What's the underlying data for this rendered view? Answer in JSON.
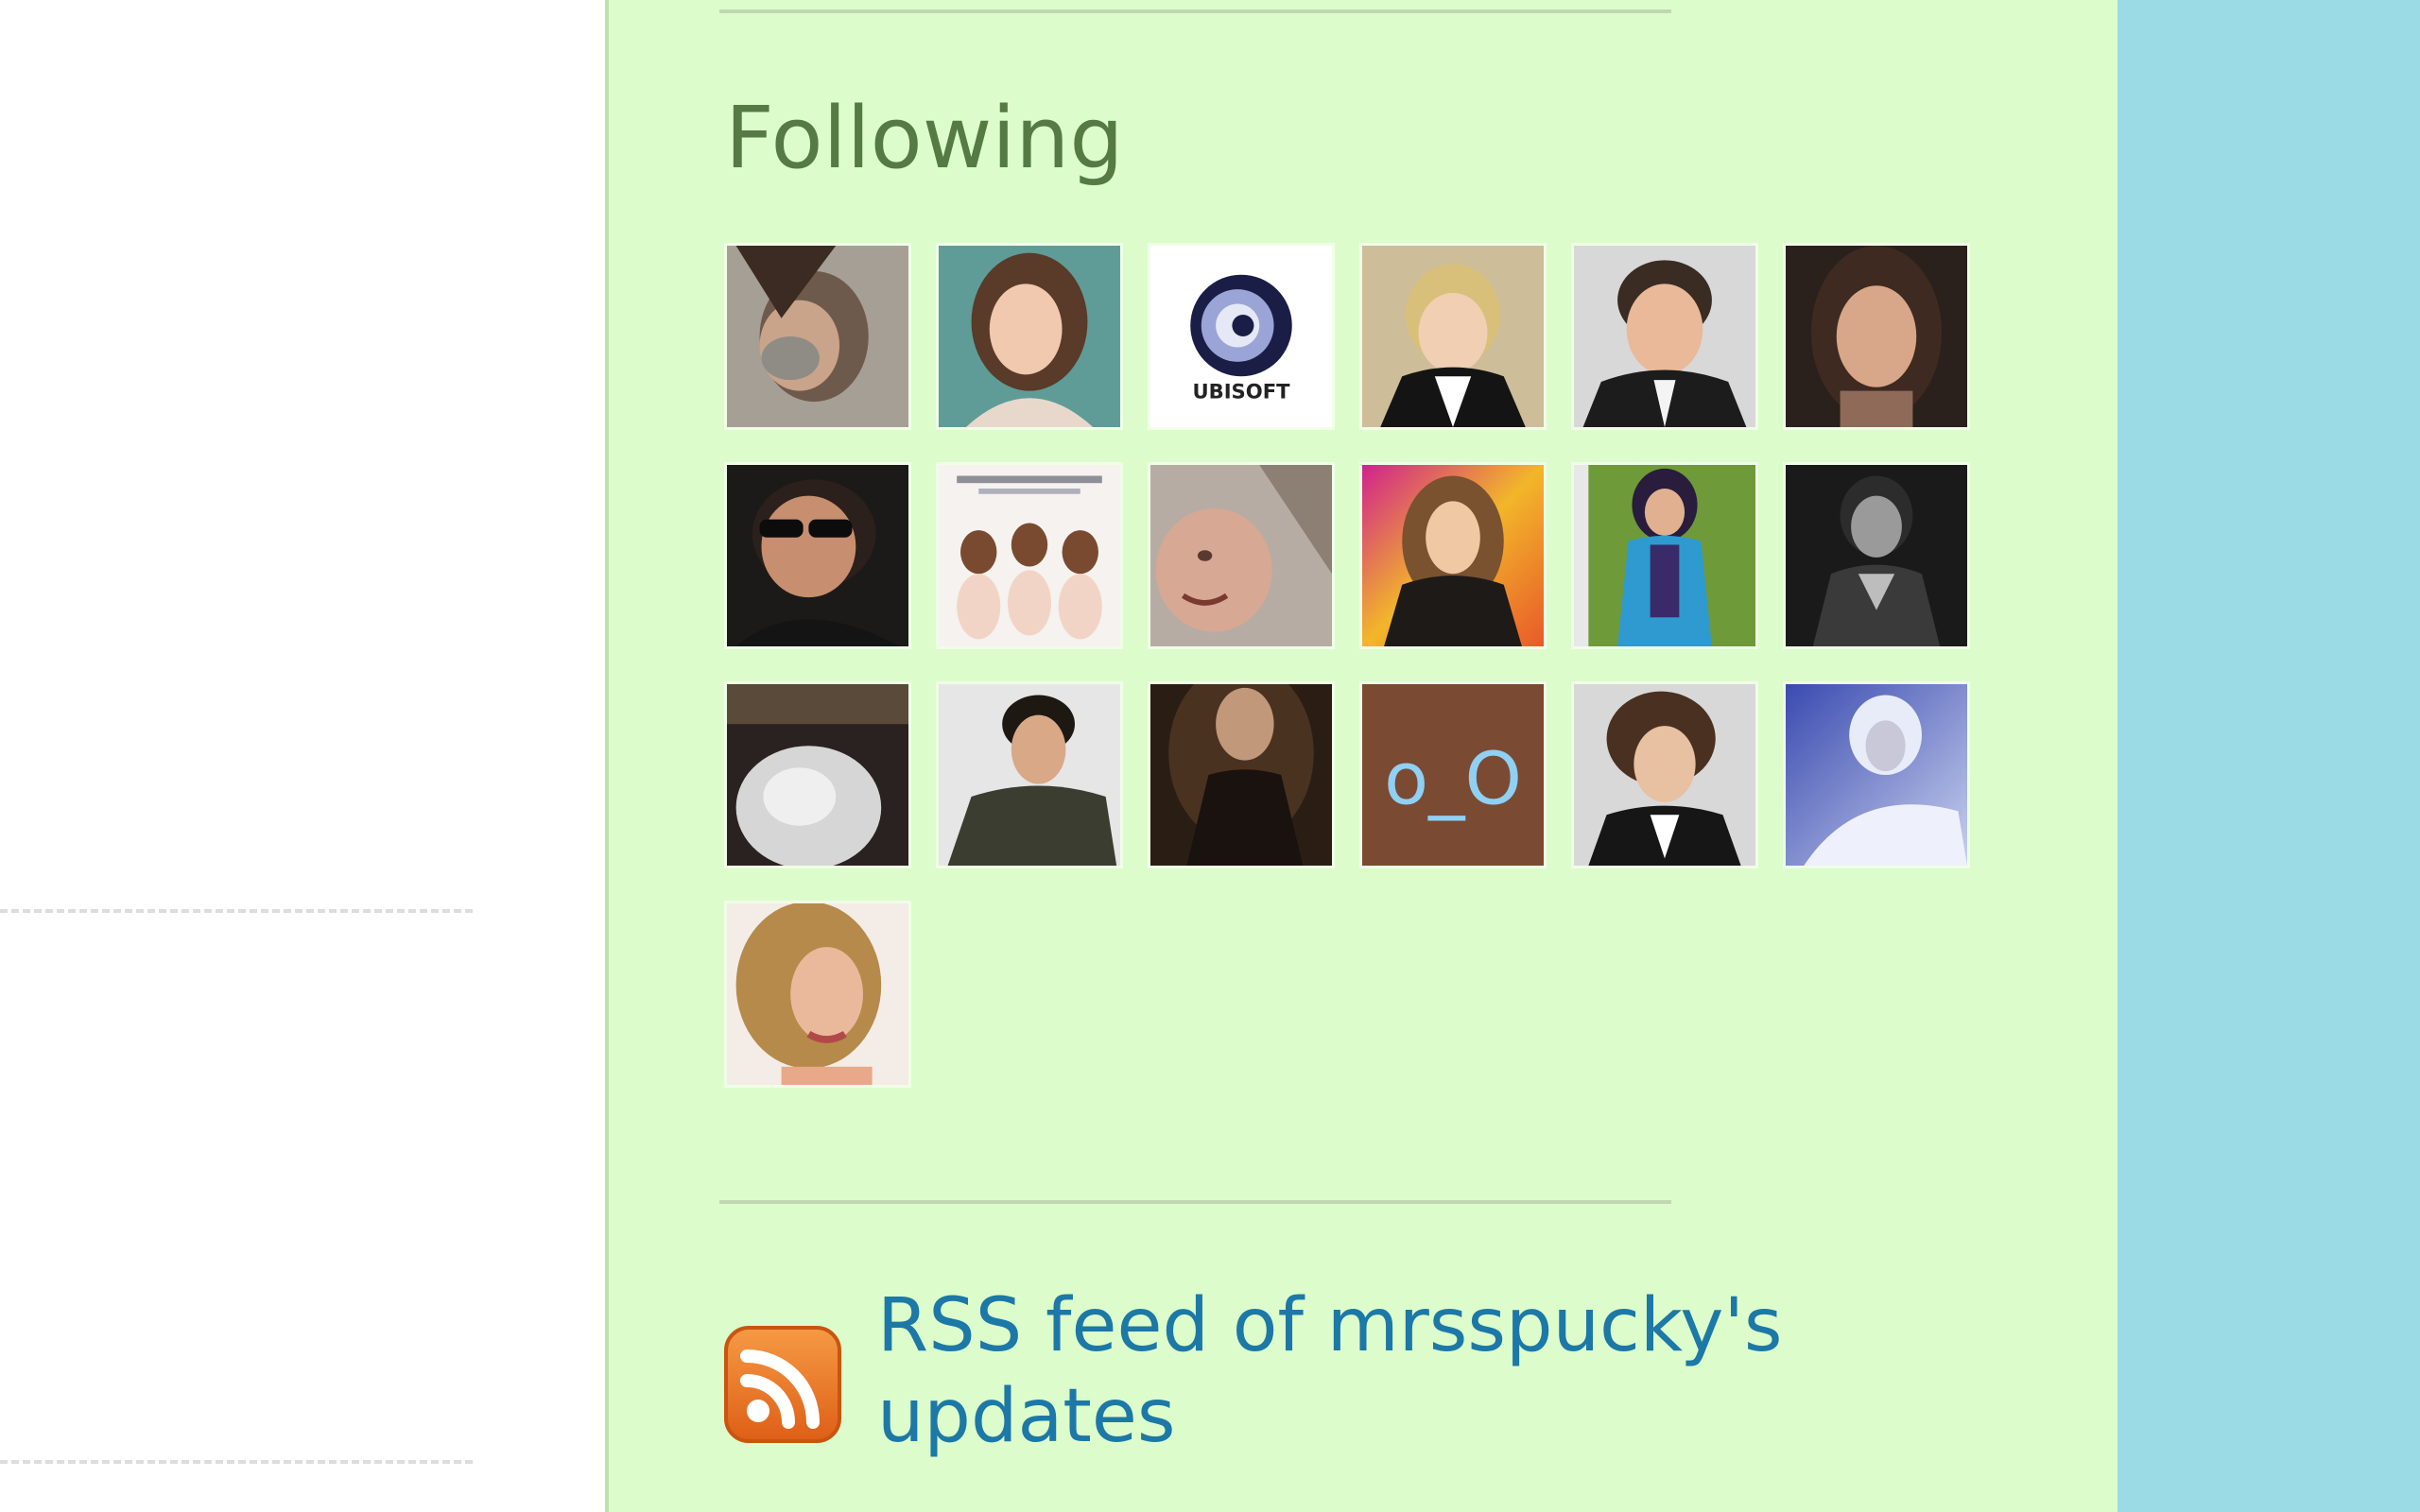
{
  "sidebar": {
    "following": {
      "heading": "Following",
      "avatars": [
        {
          "icon": "person-avatar-icon"
        },
        {
          "icon": "person-avatar-icon"
        },
        {
          "icon": "ubisoft-logo-icon",
          "logo_text": "UBISOFT"
        },
        {
          "icon": "person-avatar-icon"
        },
        {
          "icon": "person-avatar-icon"
        },
        {
          "icon": "person-avatar-icon"
        },
        {
          "icon": "person-avatar-icon"
        },
        {
          "icon": "group-avatar-icon"
        },
        {
          "icon": "person-avatar-icon"
        },
        {
          "icon": "person-avatar-icon"
        },
        {
          "icon": "person-avatar-icon"
        },
        {
          "icon": "person-avatar-icon"
        },
        {
          "icon": "abstract-avatar-icon"
        },
        {
          "icon": "person-avatar-icon"
        },
        {
          "icon": "person-avatar-icon"
        },
        {
          "icon": "face-emoticon-icon",
          "text": "o_O"
        },
        {
          "icon": "person-avatar-icon"
        },
        {
          "icon": "person-avatar-icon"
        },
        {
          "icon": "person-avatar-icon"
        }
      ]
    },
    "rss": {
      "icon": "rss-feed-icon",
      "link_text": "RSS feed of mrsspucky's updates"
    }
  },
  "colors": {
    "sidebar_background": "#ddfccb",
    "heading": "#557a44",
    "link": "#1c78a6",
    "page_background_right": "#9adbe6",
    "rss_orange": "#ee7a26"
  }
}
